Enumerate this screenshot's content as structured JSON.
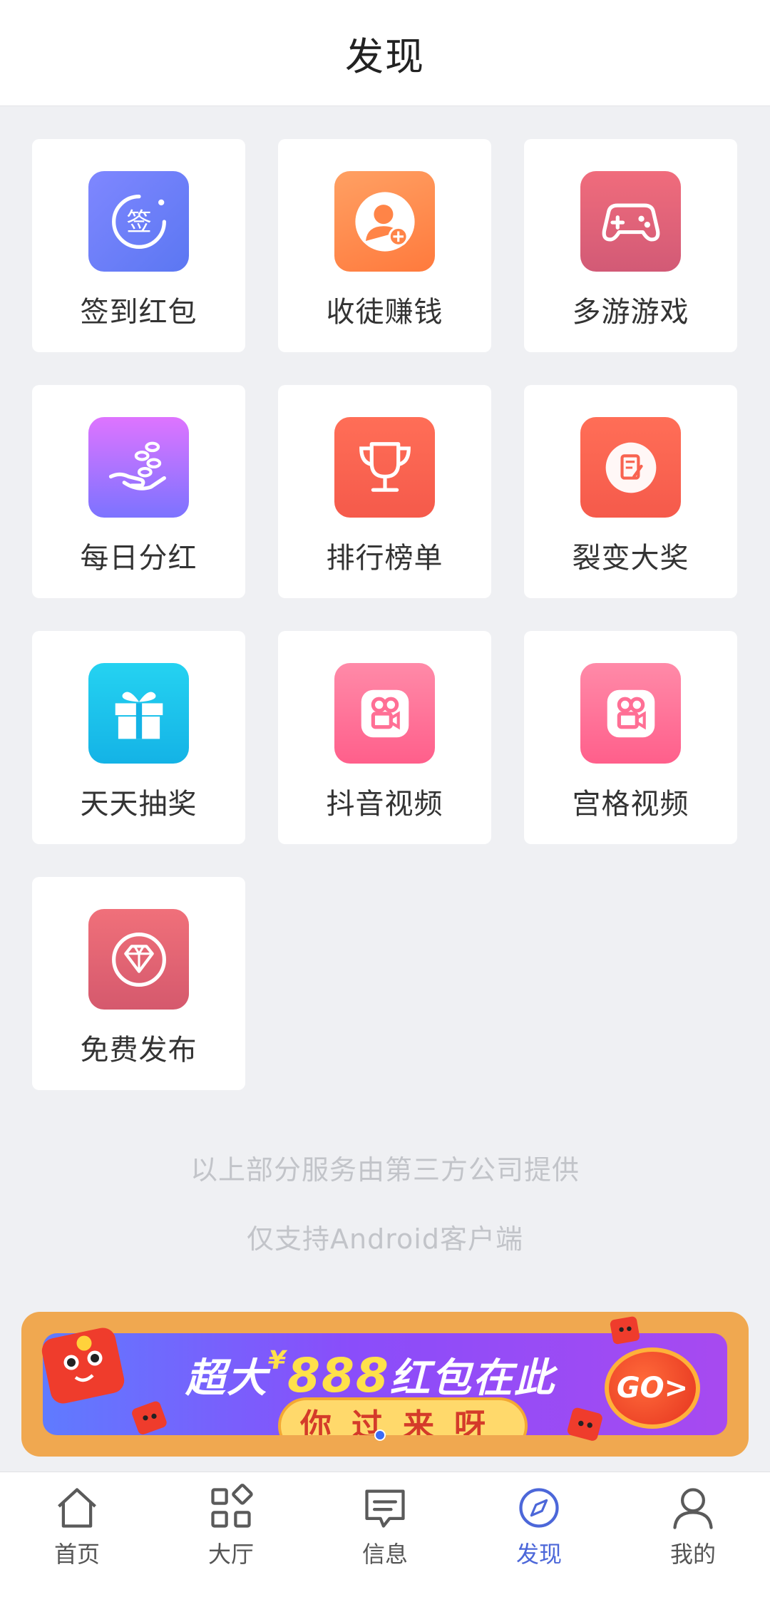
{
  "header": {
    "title": "发现"
  },
  "grid": {
    "items": [
      {
        "label": "签到红包",
        "icon": "sign-in-icon",
        "color": "#6d7ff8"
      },
      {
        "label": "收徒赚钱",
        "icon": "add-user-icon",
        "color": "#ff8a4c"
      },
      {
        "label": "多游游戏",
        "icon": "gamepad-icon",
        "color": "#e0637a"
      },
      {
        "label": "每日分红",
        "icon": "hand-coins-icon",
        "color": "#a574ff"
      },
      {
        "label": "排行榜单",
        "icon": "trophy-icon",
        "color": "#f86350"
      },
      {
        "label": "裂变大奖",
        "icon": "note-icon",
        "color": "#f86350"
      },
      {
        "label": "天天抽奖",
        "icon": "gift-icon",
        "color": "#1cc2ec"
      },
      {
        "label": "抖音视频",
        "icon": "video-camera-icon",
        "color": "#ff7399"
      },
      {
        "label": "宫格视频",
        "icon": "video-camera-icon",
        "color": "#ff7399"
      },
      {
        "label": "免费发布",
        "icon": "diamond-icon",
        "color": "#e0637a"
      }
    ]
  },
  "notes": {
    "line1": "以上部分服务由第三方公司提供",
    "line2": "仅支持Android客户端"
  },
  "banner": {
    "title_prefix": "超大",
    "currency": "¥",
    "amount": "888",
    "title_suffix": "红包在此",
    "subtitle": "你过来呀",
    "go_label": "GO>"
  },
  "tabbar": {
    "items": [
      {
        "label": "首页",
        "icon": "home-icon",
        "active": false
      },
      {
        "label": "大厅",
        "icon": "grid-icon",
        "active": false
      },
      {
        "label": "信息",
        "icon": "message-icon",
        "active": false
      },
      {
        "label": "发现",
        "icon": "compass-icon",
        "active": true
      },
      {
        "label": "我的",
        "icon": "user-icon",
        "active": false
      }
    ],
    "active_color": "#4c67d9",
    "inactive_color": "#555555"
  }
}
